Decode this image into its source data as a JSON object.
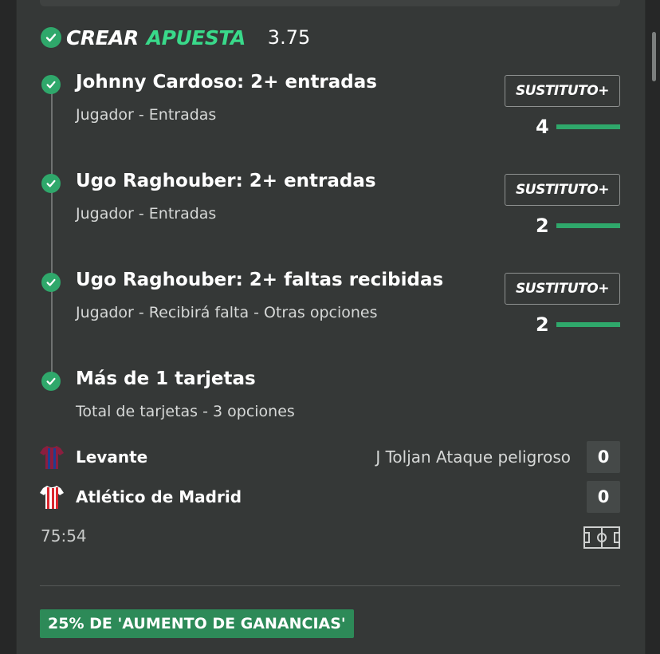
{
  "header": {
    "title_part1": "CREAR",
    "title_part2": "APUESTA",
    "odds": "3.75"
  },
  "legs": [
    {
      "title": "Johnny Cardoso: 2+ entradas",
      "subtitle": "Jugador - Entradas",
      "button_label": "SUSTITUTO+",
      "count": "4"
    },
    {
      "title": "Ugo Raghouber: 2+ entradas",
      "subtitle": "Jugador - Entradas",
      "button_label": "SUSTITUTO+",
      "count": "2"
    },
    {
      "title": "Ugo Raghouber: 2+ faltas recibidas",
      "subtitle": "Jugador - Recibirá falta - Otras opciones",
      "button_label": "SUSTITUTO+",
      "count": "2"
    },
    {
      "title": "Más de 1 tarjetas",
      "subtitle": "Total de tarjetas - 3 opciones"
    }
  ],
  "match": {
    "home": {
      "name": "Levante",
      "score": "0",
      "event": "J Toljan Ataque peligroso"
    },
    "away": {
      "name": "Atlético de Madrid",
      "score": "0"
    },
    "clock": "75:54"
  },
  "promo": {
    "label": "25% DE 'AUMENTO DE GANANCIAS'"
  },
  "colors": {
    "accent_green": "#39d98a",
    "check_green": "#2fa86b",
    "promo_green": "#2d8a58",
    "card_bg": "#353837"
  },
  "icons": [
    "check-circle-icon",
    "levante-shirt-icon",
    "atletico-shirt-icon",
    "pitch-icon"
  ]
}
